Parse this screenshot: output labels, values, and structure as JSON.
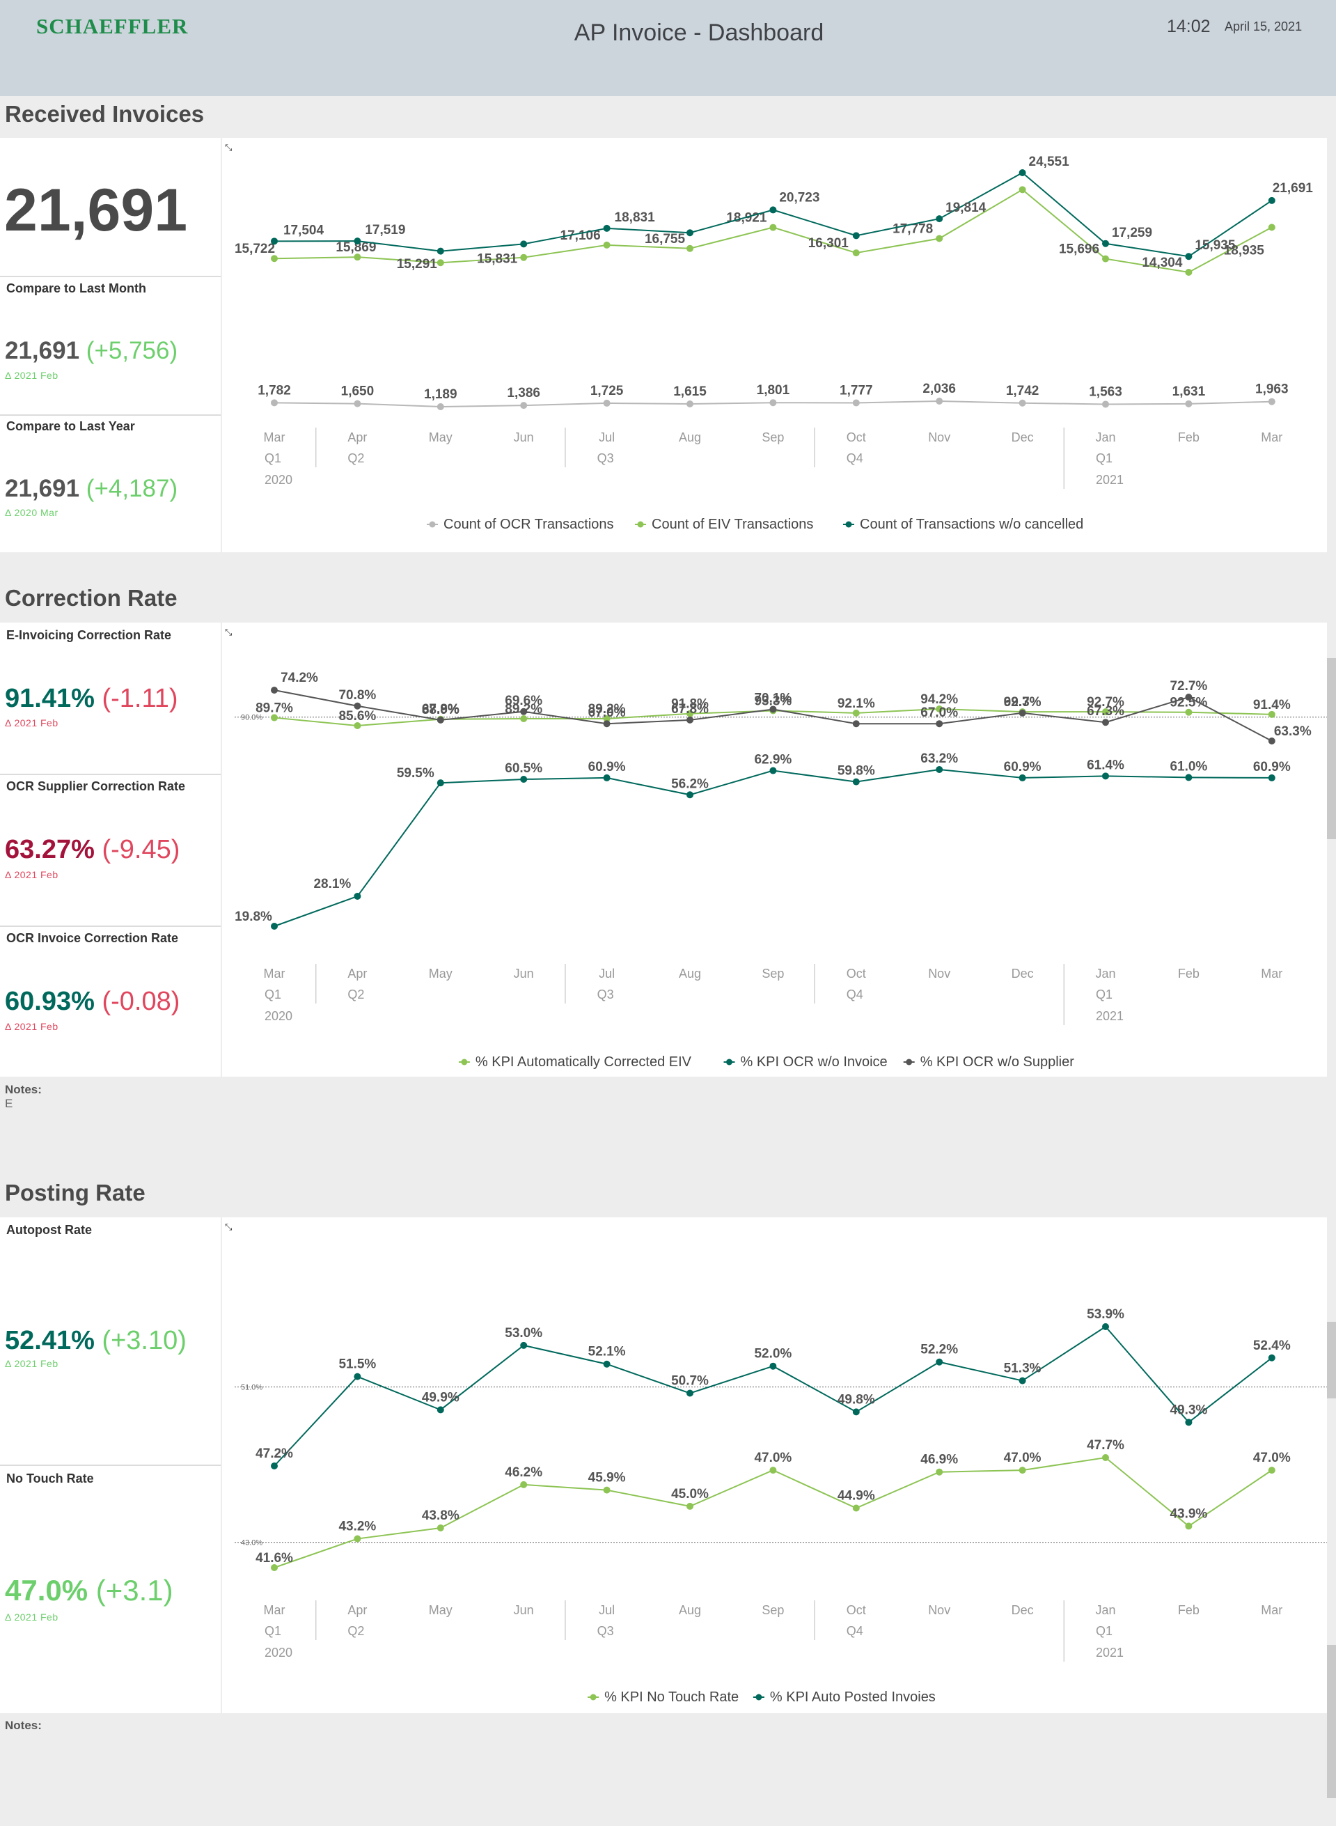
{
  "header": {
    "logo": "SCHAEFFLER",
    "title": "AP Invoice - Dashboard",
    "time": "14:02",
    "date": "April 15, 2021"
  },
  "colors": {
    "dark_green": "#00695c",
    "light_green": "#8dc454",
    "gray": "#b8b8b8",
    "dark_gray": "#555555",
    "positive": "#6ccf6c",
    "negative": "#e0475e",
    "kpi_dark_red": "#a3123a"
  },
  "axis": {
    "months": [
      "Mar",
      "Apr",
      "May",
      "Jun",
      "Jul",
      "Aug",
      "Sep",
      "Oct",
      "Nov",
      "Dec",
      "Jan",
      "Feb",
      "Mar"
    ],
    "quarters": [
      "Q1",
      "Q2",
      "Q3",
      "Q4",
      "Q1"
    ],
    "years": [
      "2020",
      "2021"
    ]
  },
  "received": {
    "title": "Received Invoices",
    "big_value": "21,691",
    "compare_month_label": "Compare to Last Month",
    "compare_month_value": "21,691",
    "compare_month_delta": "(+5,756)",
    "compare_month_sub": "Δ 2021 Feb",
    "compare_year_label": "Compare to Last Year",
    "compare_year_value": "21,691",
    "compare_year_delta": "(+4,187)",
    "compare_year_sub": "Δ 2020 Mar",
    "legend": [
      "Count of OCR Transactions",
      "Count of EIV Transactions",
      "Count of Transactions w/o cancelled"
    ]
  },
  "correction": {
    "title": "Correction Rate",
    "eiv_label": "E-Invoicing Correction Rate",
    "eiv_value": "91.41%",
    "eiv_delta": "(-1.11)",
    "eiv_sub": "Δ 2021 Feb",
    "supplier_label": "OCR Supplier Correction Rate",
    "supplier_value": "63.27%",
    "supplier_delta": "(-9.45)",
    "supplier_sub": "Δ 2021 Feb",
    "invoice_label": "OCR Invoice Correction Rate",
    "invoice_value": "60.93%",
    "invoice_delta": "(-0.08)",
    "invoice_sub": "Δ 2021 Feb",
    "threshold_label": "90.0%",
    "legend": [
      "% KPI Automatically Corrected EIV",
      "% KPI OCR w/o Invoice",
      "% KPI OCR w/o Supplier"
    ],
    "notes_label": "Notes:",
    "notes_text": "E"
  },
  "posting": {
    "title": "Posting Rate",
    "autopost_label": "Autopost Rate",
    "autopost_value": "52.41%",
    "autopost_delta": "(+3.10)",
    "autopost_sub": "Δ 2021 Feb",
    "notouch_label": "No Touch Rate",
    "notouch_value": "47.0%",
    "notouch_delta": "(+3.1)",
    "notouch_sub": "Δ 2021 Feb",
    "threshold_top_label": "51.0%",
    "threshold_bottom_label": "43.0%",
    "legend": [
      "% KPI No Touch Rate",
      "% KPI Auto Posted Invoies"
    ],
    "notes_label": "Notes:"
  },
  "chart_data": [
    {
      "type": "line",
      "categories": [
        "Mar 2020",
        "Apr 2020",
        "May 2020",
        "Jun 2020",
        "Jul 2020",
        "Aug 2020",
        "Sep 2020",
        "Oct 2020",
        "Nov 2020",
        "Dec 2020",
        "Jan 2021",
        "Feb 2021",
        "Mar 2021"
      ],
      "series": [
        {
          "name": "Count of OCR Transactions",
          "values": [
            1782,
            1650,
            1189,
            1386,
            1725,
            1615,
            1801,
            1777,
            2036,
            1742,
            1563,
            1631,
            1963
          ],
          "labels": [
            "1,782",
            "1,650",
            "1,189",
            "1,386",
            "1,725",
            "1,615",
            "1,801",
            "1,777",
            "2,036",
            "1,742",
            "1,563",
            "1,631",
            "1,963"
          ]
        },
        {
          "name": "Count of EIV Transactions",
          "values": [
            15722,
            15869,
            15291,
            15831,
            17106,
            16755,
            18921,
            16301,
            17778,
            22808,
            15696,
            14304,
            18935
          ],
          "labels": [
            "15,722",
            "15,869",
            "15,291",
            "15,831",
            "17,106",
            "16,755",
            "18,921",
            "16,301",
            "17,778",
            "22,808",
            "15,696",
            "14,304",
            "18,935"
          ]
        },
        {
          "name": "Count of Transactions w/o cancelled",
          "values": [
            17504,
            17519,
            16480,
            17217,
            18831,
            18370,
            20723,
            18078,
            19814,
            24551,
            17259,
            15935,
            21691
          ],
          "labels": [
            "17,504",
            "17,519",
            "",
            "",
            "18,831",
            "",
            "20,723",
            "",
            "19,814",
            "24,551",
            "17,259",
            "15,935",
            "21,691"
          ]
        }
      ]
    },
    {
      "type": "line",
      "categories": [
        "Mar 2020",
        "Apr 2020",
        "May 2020",
        "Jun 2020",
        "Jul 2020",
        "Aug 2020",
        "Sep 2020",
        "Oct 2020",
        "Nov 2020",
        "Dec 2020",
        "Jan 2021",
        "Feb 2021",
        "Mar 2021"
      ],
      "series": [
        {
          "name": "% KPI Automatically Corrected EIV",
          "values": [
            89.7,
            85.6,
            88.9,
            89.2,
            89.2,
            91.8,
            93.3,
            92.1,
            94.2,
            92.7,
            92.7,
            92.5,
            91.4
          ],
          "labels": [
            "89.7%",
            "85.6%",
            "88.9%",
            "89.2%",
            "89.2%",
            "91.8%",
            "93.3%",
            "92.1%",
            "94.2%",
            "92.7%",
            "92.7%",
            "92.5%",
            "91.4%"
          ]
        },
        {
          "name": "% KPI OCR w/o Supplier",
          "values": [
            74.2,
            70.8,
            67.8,
            69.6,
            67.0,
            67.8,
            70.1,
            67.0,
            67.0,
            69.3,
            67.3,
            72.7,
            63.3
          ],
          "labels": [
            "74.2%",
            "70.8%",
            "67.8%",
            "69.6%",
            "67.0%",
            "67.8%",
            "70.1%",
            "",
            "67.0%",
            "69.3%",
            "67.3%",
            "72.7%",
            "63.3%"
          ]
        },
        {
          "name": "% KPI OCR w/o Invoice",
          "values": [
            19.8,
            28.1,
            59.5,
            60.5,
            60.9,
            56.2,
            62.9,
            59.8,
            63.2,
            60.9,
            61.4,
            61.0,
            60.9
          ],
          "labels": [
            "19.8%",
            "28.1%",
            "59.5%",
            "60.5%",
            "60.9%",
            "56.2%",
            "62.9%",
            "59.8%",
            "63.2%",
            "60.9%",
            "61.4%",
            "61.0%",
            "60.9%"
          ]
        }
      ],
      "reference_line": 90.0
    },
    {
      "type": "line",
      "categories": [
        "Mar 2020",
        "Apr 2020",
        "May 2020",
        "Jun 2020",
        "Jul 2020",
        "Aug 2020",
        "Sep 2020",
        "Oct 2020",
        "Nov 2020",
        "Dec 2020",
        "Jan 2021",
        "Feb 2021",
        "Mar 2021"
      ],
      "series": [
        {
          "name": "% KPI Auto Posted Invoies",
          "values": [
            47.2,
            51.5,
            49.9,
            53.0,
            52.1,
            50.7,
            52.0,
            49.8,
            52.2,
            51.3,
            53.9,
            49.3,
            52.4
          ],
          "labels": [
            "47.2%",
            "51.5%",
            "49.9%",
            "53.0%",
            "52.1%",
            "50.7%",
            "52.0%",
            "49.8%",
            "52.2%",
            "51.3%",
            "53.9%",
            "49.3%",
            "52.4%"
          ]
        },
        {
          "name": "% KPI No Touch Rate",
          "values": [
            41.6,
            43.2,
            43.8,
            46.2,
            45.9,
            45.0,
            47.0,
            44.9,
            46.9,
            47.0,
            47.7,
            43.9,
            47.0
          ],
          "labels": [
            "41.6%",
            "43.2%",
            "43.8%",
            "46.2%",
            "45.9%",
            "45.0%",
            "47.0%",
            "44.9%",
            "46.9%",
            "47.0%",
            "47.7%",
            "43.9%",
            "47.0%"
          ]
        }
      ],
      "reference_lines": [
        51.0,
        43.0
      ]
    }
  ]
}
